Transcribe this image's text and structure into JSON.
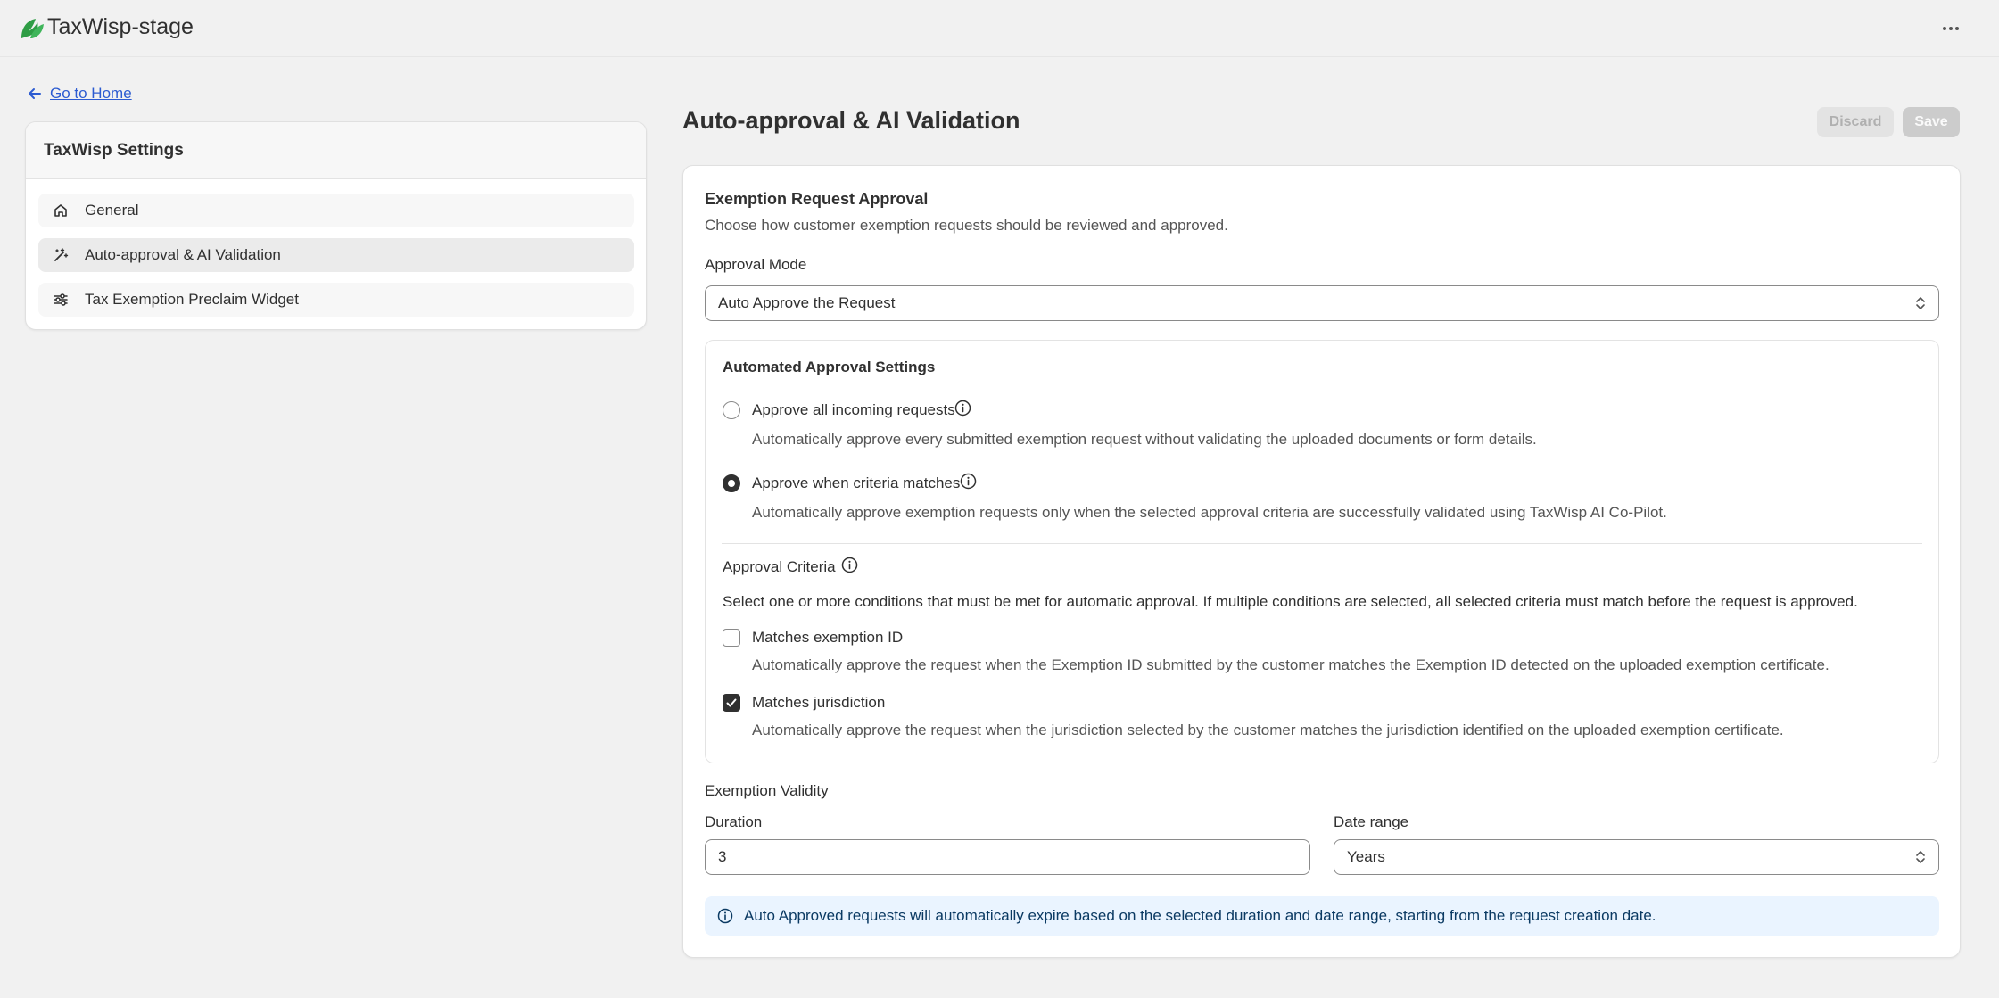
{
  "app": {
    "title": "TaxWisp-stage"
  },
  "nav": {
    "back_label": "Go to Home"
  },
  "sidebar": {
    "title": "TaxWisp Settings",
    "items": [
      {
        "label": "General",
        "icon": "home-icon"
      },
      {
        "label": "Auto-approval & AI Validation",
        "icon": "magic-wand-icon"
      },
      {
        "label": "Tax Exemption Preclaim Widget",
        "icon": "sliders-icon"
      }
    ]
  },
  "page": {
    "title": "Auto-approval & AI Validation",
    "discard_label": "Discard",
    "save_label": "Save"
  },
  "approval": {
    "title": "Exemption Request Approval",
    "subtitle": "Choose how customer exemption requests should be reviewed and approved.",
    "mode_label": "Approval Mode",
    "mode_value": "Auto Approve the Request",
    "automated": {
      "title": "Automated Approval Settings",
      "options": [
        {
          "label": "Approve all incoming requests",
          "description": "Automatically approve every submitted exemption request without validating the uploaded documents or form details.",
          "selected": false
        },
        {
          "label": "Approve when criteria matches",
          "description": "Automatically approve exemption requests only when the selected approval criteria are successfully validated using TaxWisp AI Co-Pilot.",
          "selected": true
        }
      ]
    },
    "criteria": {
      "title": "Approval Criteria",
      "description": "Select one or more conditions that must be met for automatic approval. If multiple conditions are selected, all selected criteria must match before the request is approved.",
      "items": [
        {
          "label": "Matches exemption ID",
          "description": "Automatically approve the request when the Exemption ID submitted by the customer matches the Exemption ID detected on the uploaded exemption certificate.",
          "checked": false
        },
        {
          "label": "Matches jurisdiction",
          "description": "Automatically approve the request when the jurisdiction selected by the customer matches the jurisdiction identified on the uploaded exemption certificate.",
          "checked": true
        }
      ]
    }
  },
  "validity": {
    "title": "Exemption Validity",
    "duration_label": "Duration",
    "duration_value": "3",
    "range_label": "Date range",
    "range_value": "Years",
    "banner": "Auto Approved requests will automatically expire based on the selected duration and date range, starting from the request creation date."
  },
  "colors": {
    "accent": "#303030",
    "link": "#2c5bd1",
    "info_bg": "#eaf4ff",
    "logo": "#2e9d45"
  }
}
